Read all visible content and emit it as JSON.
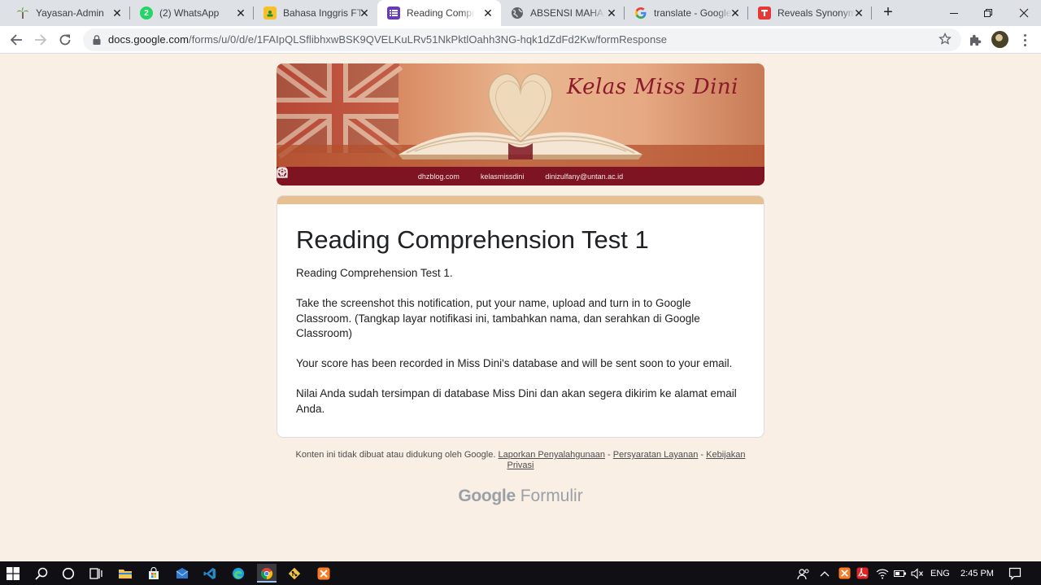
{
  "browser": {
    "tabs": [
      {
        "title": "Yayasan-Admin",
        "icon": "palm-icon",
        "color": "#5b9a3c",
        "active": false
      },
      {
        "title": "(2) WhatsApp",
        "icon": "whatsapp-icon",
        "badge": "2",
        "color": "#25d366",
        "active": false
      },
      {
        "title": "Bahasa Inggris FT",
        "icon": "classroom-icon",
        "color": "#f6c026",
        "active": false
      },
      {
        "title": "Reading Comprehension",
        "icon": "forms-icon",
        "color": "#673ab7",
        "active": true
      },
      {
        "title": "ABSENSI MAHASISWA",
        "icon": "globe-icon",
        "color": "#5f6368",
        "active": false
      },
      {
        "title": "translate - Google",
        "icon": "google-icon",
        "color": "#4285f4",
        "active": false
      },
      {
        "title": "Reveals Synonyms",
        "icon": "thesaurus-icon",
        "color": "#e53935",
        "active": false
      }
    ],
    "url_host": "docs.google.com",
    "url_path": "/forms/u/0/d/e/1FAIpQLSflibhxwBSK9QVELKuLRv51NkPktlOahh3NG-hqk1dZdFd2Kw/formResponse"
  },
  "banner": {
    "brand": "Kelas Miss Dini",
    "website": "dhzblog.com",
    "instagram": "kelasmissdini",
    "email": "dinizulfany@untan.ac.id"
  },
  "form": {
    "accent_color": "#e8bf90",
    "title": "Reading Comprehension Test 1",
    "paragraphs": [
      "Reading Comprehension Test 1.",
      "Take the screenshot this notification, put your name, upload and turn in to Google Classroom. (Tangkap layar notifikasi ini, tambahkan nama, dan serahkan di Google Classroom)",
      "Your score has been recorded in Miss Dini's database and will be sent soon to your email.",
      "Nilai Anda sudah tersimpan di database Miss Dini dan akan segera dikirim ke alamat email Anda."
    ]
  },
  "footer": {
    "disclaimer": "Konten ini tidak dibuat atau didukung oleh Google.",
    "link_abuse": "Laporkan Penyalahgunaan",
    "link_terms": "Persyaratan Layanan",
    "link_privacy": "Kebijakan Privasi",
    "separator": " - ",
    "brand_google": "Google",
    "brand_forms": "Formulir"
  },
  "taskbar": {
    "language": "ENG",
    "time": "2:45 PM",
    "pinned": [
      "start-icon",
      "search-icon",
      "cortana-icon",
      "task-view-icon",
      "file-explorer-icon",
      "store-icon",
      "mail-icon",
      "vscode-icon",
      "edge-icon",
      "chrome-icon",
      "git-icon",
      "xampp-icon"
    ]
  }
}
